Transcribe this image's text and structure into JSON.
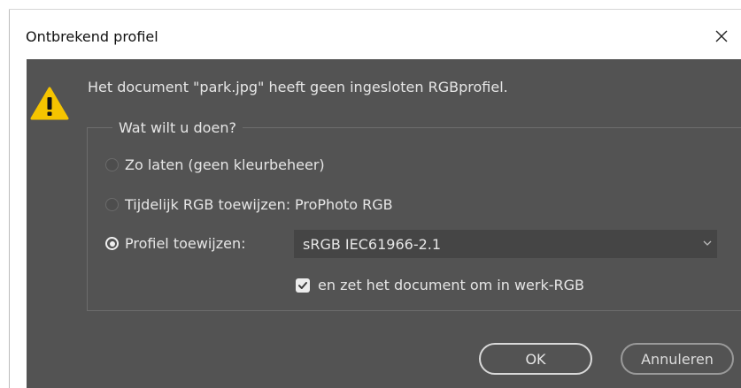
{
  "window": {
    "title": "Ontbrekend profiel",
    "close_icon": "close-icon"
  },
  "message": {
    "icon": "warning-icon",
    "text": "Het document \"park.jpg\" heeft geen ingesloten RGBprofiel."
  },
  "options": {
    "legend": "Wat wilt u doen?",
    "leave_label": "Zo laten (geen kleurbeheer)",
    "temporary_label": "Tijdelijk RGB toewijzen:",
    "temporary_value": "ProPhoto RGB",
    "assign_label": "Profiel toewijzen:",
    "selected_option": "assign",
    "profile_value": "sRGB IEC61966-2.1",
    "convert_label": "en zet het document om in werk-RGB",
    "convert_checked": true
  },
  "buttons": {
    "ok": "OK",
    "cancel": "Annuleren"
  },
  "colors": {
    "dialog_background": "#535353",
    "title_background": "#ffffff",
    "warning_yellow": "#f5c400",
    "text": "#e6e6e6"
  }
}
